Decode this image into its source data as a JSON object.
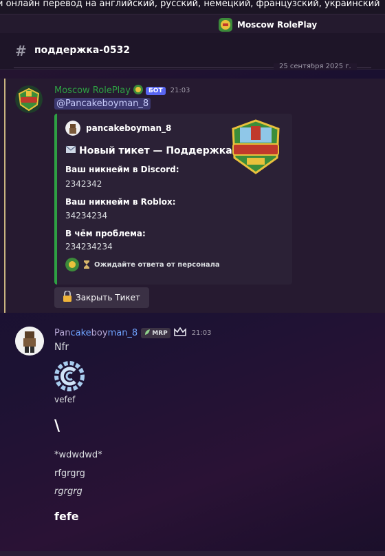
{
  "top_strip_text": "и онлайн перевод на английский, русский, немецкий, французский, украинский",
  "server": {
    "name": "Moscow RolePlay"
  },
  "channel": {
    "name": "поддержка-0532"
  },
  "date_divider": "25 сентября 2025 г.",
  "bot_message": {
    "author": "Moscow RolePlay",
    "badge": "БОТ",
    "time": "21:03",
    "mention": "@Pancakeboyman_8",
    "embed": {
      "author": "pancakeboyman_8",
      "title": "Новый тикет — Поддержка",
      "fields": [
        {
          "name": "Ваш никнейм в Discord:",
          "value": "2342342"
        },
        {
          "name": "Ваш никнейм в Roblox:",
          "value": "34234234"
        },
        {
          "name": "В чём проблема:",
          "value": "234234234"
        }
      ],
      "footer": "Ожидайте ответа от персонала",
      "accent_color": "#2ea043"
    },
    "button_label": "Закрыть Тикет"
  },
  "user_message": {
    "author": "Pancakeboyman_8",
    "tag": "MRP",
    "time": "21:03",
    "lines": {
      "first": "Nfr",
      "emoji_caption": "vefef",
      "backslash": "\\",
      "asterisk": "*wdwdwd*",
      "plain": "rfgrgrg",
      "italic": "rgrgrg",
      "bold": "fefe"
    }
  }
}
